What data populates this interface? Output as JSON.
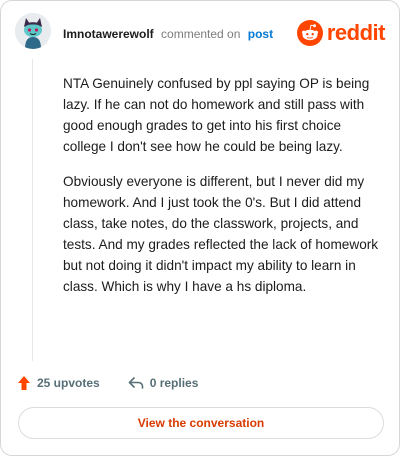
{
  "header": {
    "username": "Imnotawerewolf",
    "action_text": "commented on",
    "target_link": "post",
    "brand": "reddit"
  },
  "comment": {
    "paragraphs": [
      "NTA Genuinely confused by ppl saying OP is being lazy. If he can not do homework and still pass with good enough grades to get into his first choice college I don't see how he could be being lazy.",
      "Obviously everyone is different, but I never did my homework. And I just took the 0's. But I did attend class, take notes, do the classwork, projects, and tests. And my grades reflected the lack of homework but not doing it didn't impact my ability to learn in class. Which is why I have a hs diploma."
    ]
  },
  "actions": {
    "upvotes": "25 upvotes",
    "replies": "0 replies"
  },
  "footer": {
    "view_button": "View the conversation"
  },
  "colors": {
    "brand_orange": "#ff4500",
    "upvote_orange": "#ff4500",
    "link_blue": "#0079d3",
    "button_text": "#d93a00"
  }
}
